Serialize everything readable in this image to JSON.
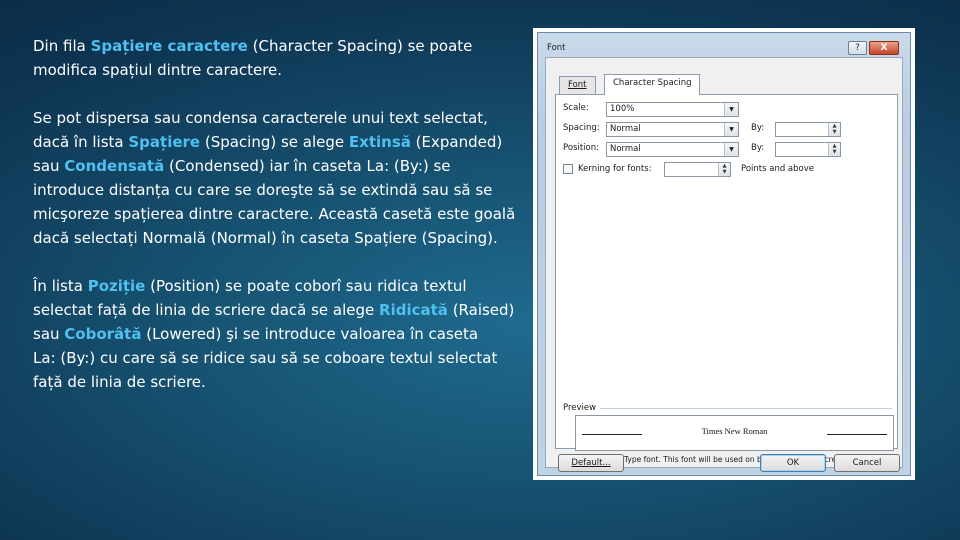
{
  "slide": {
    "paragraphs": [
      [
        {
          "t": "Din fila ",
          "h": false
        },
        {
          "t": "Spațiere caractere",
          "h": true
        },
        {
          "t": " (Character Spacing) se poate modifica spațiul dintre caractere.",
          "h": false
        }
      ],
      [
        {
          "t": "Se pot dispersa sau condensa caracterele unui text selectat, dacă în lista ",
          "h": false
        },
        {
          "t": "Spațiere",
          "h": true
        },
        {
          "t": " (Spacing) se alege ",
          "h": false
        },
        {
          "t": "Extinsă",
          "h": true
        },
        {
          "t": " (Expanded) sau ",
          "h": false
        },
        {
          "t": "Condensată",
          "h": true
        },
        {
          "t": " (Condensed) iar în caseta La: (By:) se introduce distanța cu care se doreşte să se extindă sau să se micşoreze spațierea dintre caractere. Această casetă este goală dacă selectați Normală (Normal) în caseta Spațiere (Spacing).",
          "h": false
        }
      ],
      [
        {
          "t": "În lista ",
          "h": false
        },
        {
          "t": "Poziție",
          "h": true
        },
        {
          "t": " (Position) se poate coborî sau ridica textul selectat față de linia de scriere dacă se alege ",
          "h": false
        },
        {
          "t": "Ridicată",
          "h": true
        },
        {
          "t": " (Raised) sau ",
          "h": false
        },
        {
          "t": "Coborâtă",
          "h": true
        },
        {
          "t": " (Lowered) şi se introduce valoarea în caseta\nLa: (By:) cu care să se ridice sau să se coboare textul selectat față de linia de scriere.",
          "h": false
        }
      ]
    ]
  },
  "dialog": {
    "title": "Font",
    "help_label": "?",
    "close_label": "X",
    "tabs": [
      "Font",
      "Character Spacing"
    ],
    "scale": {
      "label": "Scale:",
      "value": "100%"
    },
    "spacing": {
      "label": "Spacing:",
      "value": "Normal",
      "by_label": "By:",
      "by_value": ""
    },
    "position": {
      "label": "Position:",
      "value": "Normal",
      "by_label": "By:",
      "by_value": ""
    },
    "kerning": {
      "label": "Kerning for fonts:",
      "value": "",
      "suffix": "Points and above",
      "checked": false
    },
    "preview": {
      "label": "Preview",
      "sample": "Times New Roman",
      "note": "This is a TrueType font. This font will be used on both printer and screen."
    },
    "buttons": {
      "default": "Default...",
      "ok": "OK",
      "cancel": "Cancel"
    }
  },
  "colors": {
    "highlight": "#4fc0f0",
    "background": "#16506f"
  }
}
